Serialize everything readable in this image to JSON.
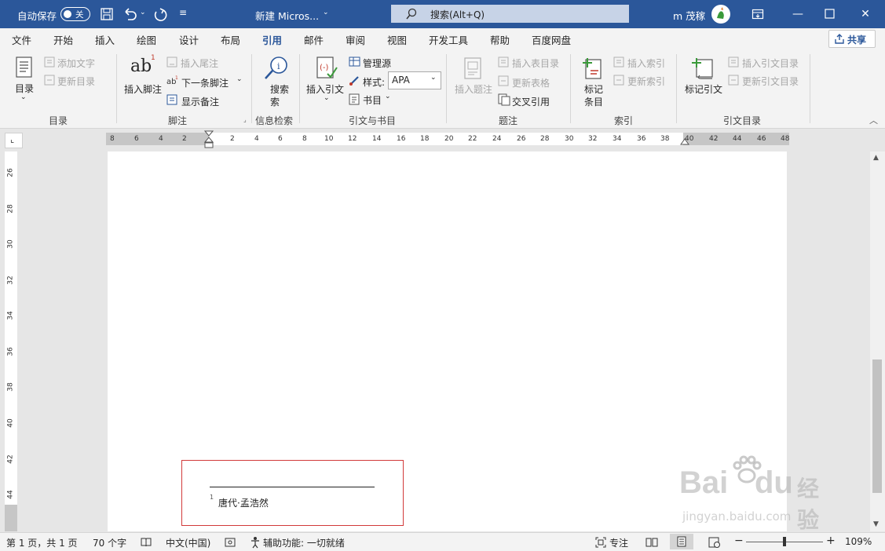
{
  "titlebar": {
    "autosave_label": "自动保存",
    "autosave_state": "关",
    "doc_title": "新建 Micros...",
    "search_label": "搜索(Alt+Q)",
    "user_name": "m 茂稼"
  },
  "tabs": [
    "文件",
    "开始",
    "插入",
    "绘图",
    "设计",
    "布局",
    "引用",
    "邮件",
    "审阅",
    "视图",
    "开发工具",
    "帮助",
    "百度网盘"
  ],
  "active_tab": "引用",
  "share_label": "共享",
  "ribbon": {
    "toc": {
      "label": "目录",
      "add_text": "添加文字",
      "update_toc": "更新目录",
      "group": "目录"
    },
    "footnotes": {
      "insert_footnote": "插入脚注",
      "insert_endnote": "插入尾注",
      "next_footnote": "下一条脚注",
      "show_notes": "显示备注",
      "group": "脚注",
      "ab": "ab",
      "sup": "1"
    },
    "research": {
      "search": "搜索",
      "search_2": "索",
      "group": "信息检索"
    },
    "citations": {
      "insert_citation": "插入引文",
      "manage_sources": "管理源",
      "style_label": "样式:",
      "style_value": "APA",
      "bibliography": "书目",
      "group": "引文与书目"
    },
    "captions": {
      "insert_caption": "插入题注",
      "insert_table_of_figures": "插入表目录",
      "update_table": "更新表格",
      "cross_reference": "交叉引用",
      "group": "题注"
    },
    "index": {
      "mark_entry_1": "标记",
      "mark_entry_2": "条目",
      "insert_index": "插入索引",
      "update_index": "更新索引",
      "group": "索引"
    },
    "toa": {
      "mark_citation": "标记引文",
      "insert_toa": "插入引文目录",
      "update_toa": "更新引文目录",
      "group": "引文目录"
    }
  },
  "hruler_numbers": [
    "8",
    "6",
    "4",
    "2",
    "2",
    "4",
    "6",
    "8",
    "10",
    "12",
    "14",
    "16",
    "18",
    "20",
    "22",
    "24",
    "26",
    "28",
    "30",
    "32",
    "34",
    "36",
    "38",
    "40",
    "42",
    "44",
    "46",
    "48"
  ],
  "vruler_numbers": [
    "26",
    "28",
    "30",
    "32",
    "34",
    "36",
    "38",
    "40",
    "42",
    "44"
  ],
  "footnote": {
    "mark": "1",
    "text": "唐代·孟浩然"
  },
  "status": {
    "page": "第 1 页，共 1 页",
    "words": "70 个字",
    "language": "中文(中国)",
    "accessibility": "辅助功能: 一切就绪",
    "focus": "专注",
    "zoom": "109%"
  },
  "watermark": {
    "brand": "Bai",
    "brand_suffix": "du",
    "cn": "经验",
    "url": "jingyan.baidu.com"
  },
  "colors": {
    "accent": "#2b579a",
    "highlight": "#d23a3a"
  }
}
